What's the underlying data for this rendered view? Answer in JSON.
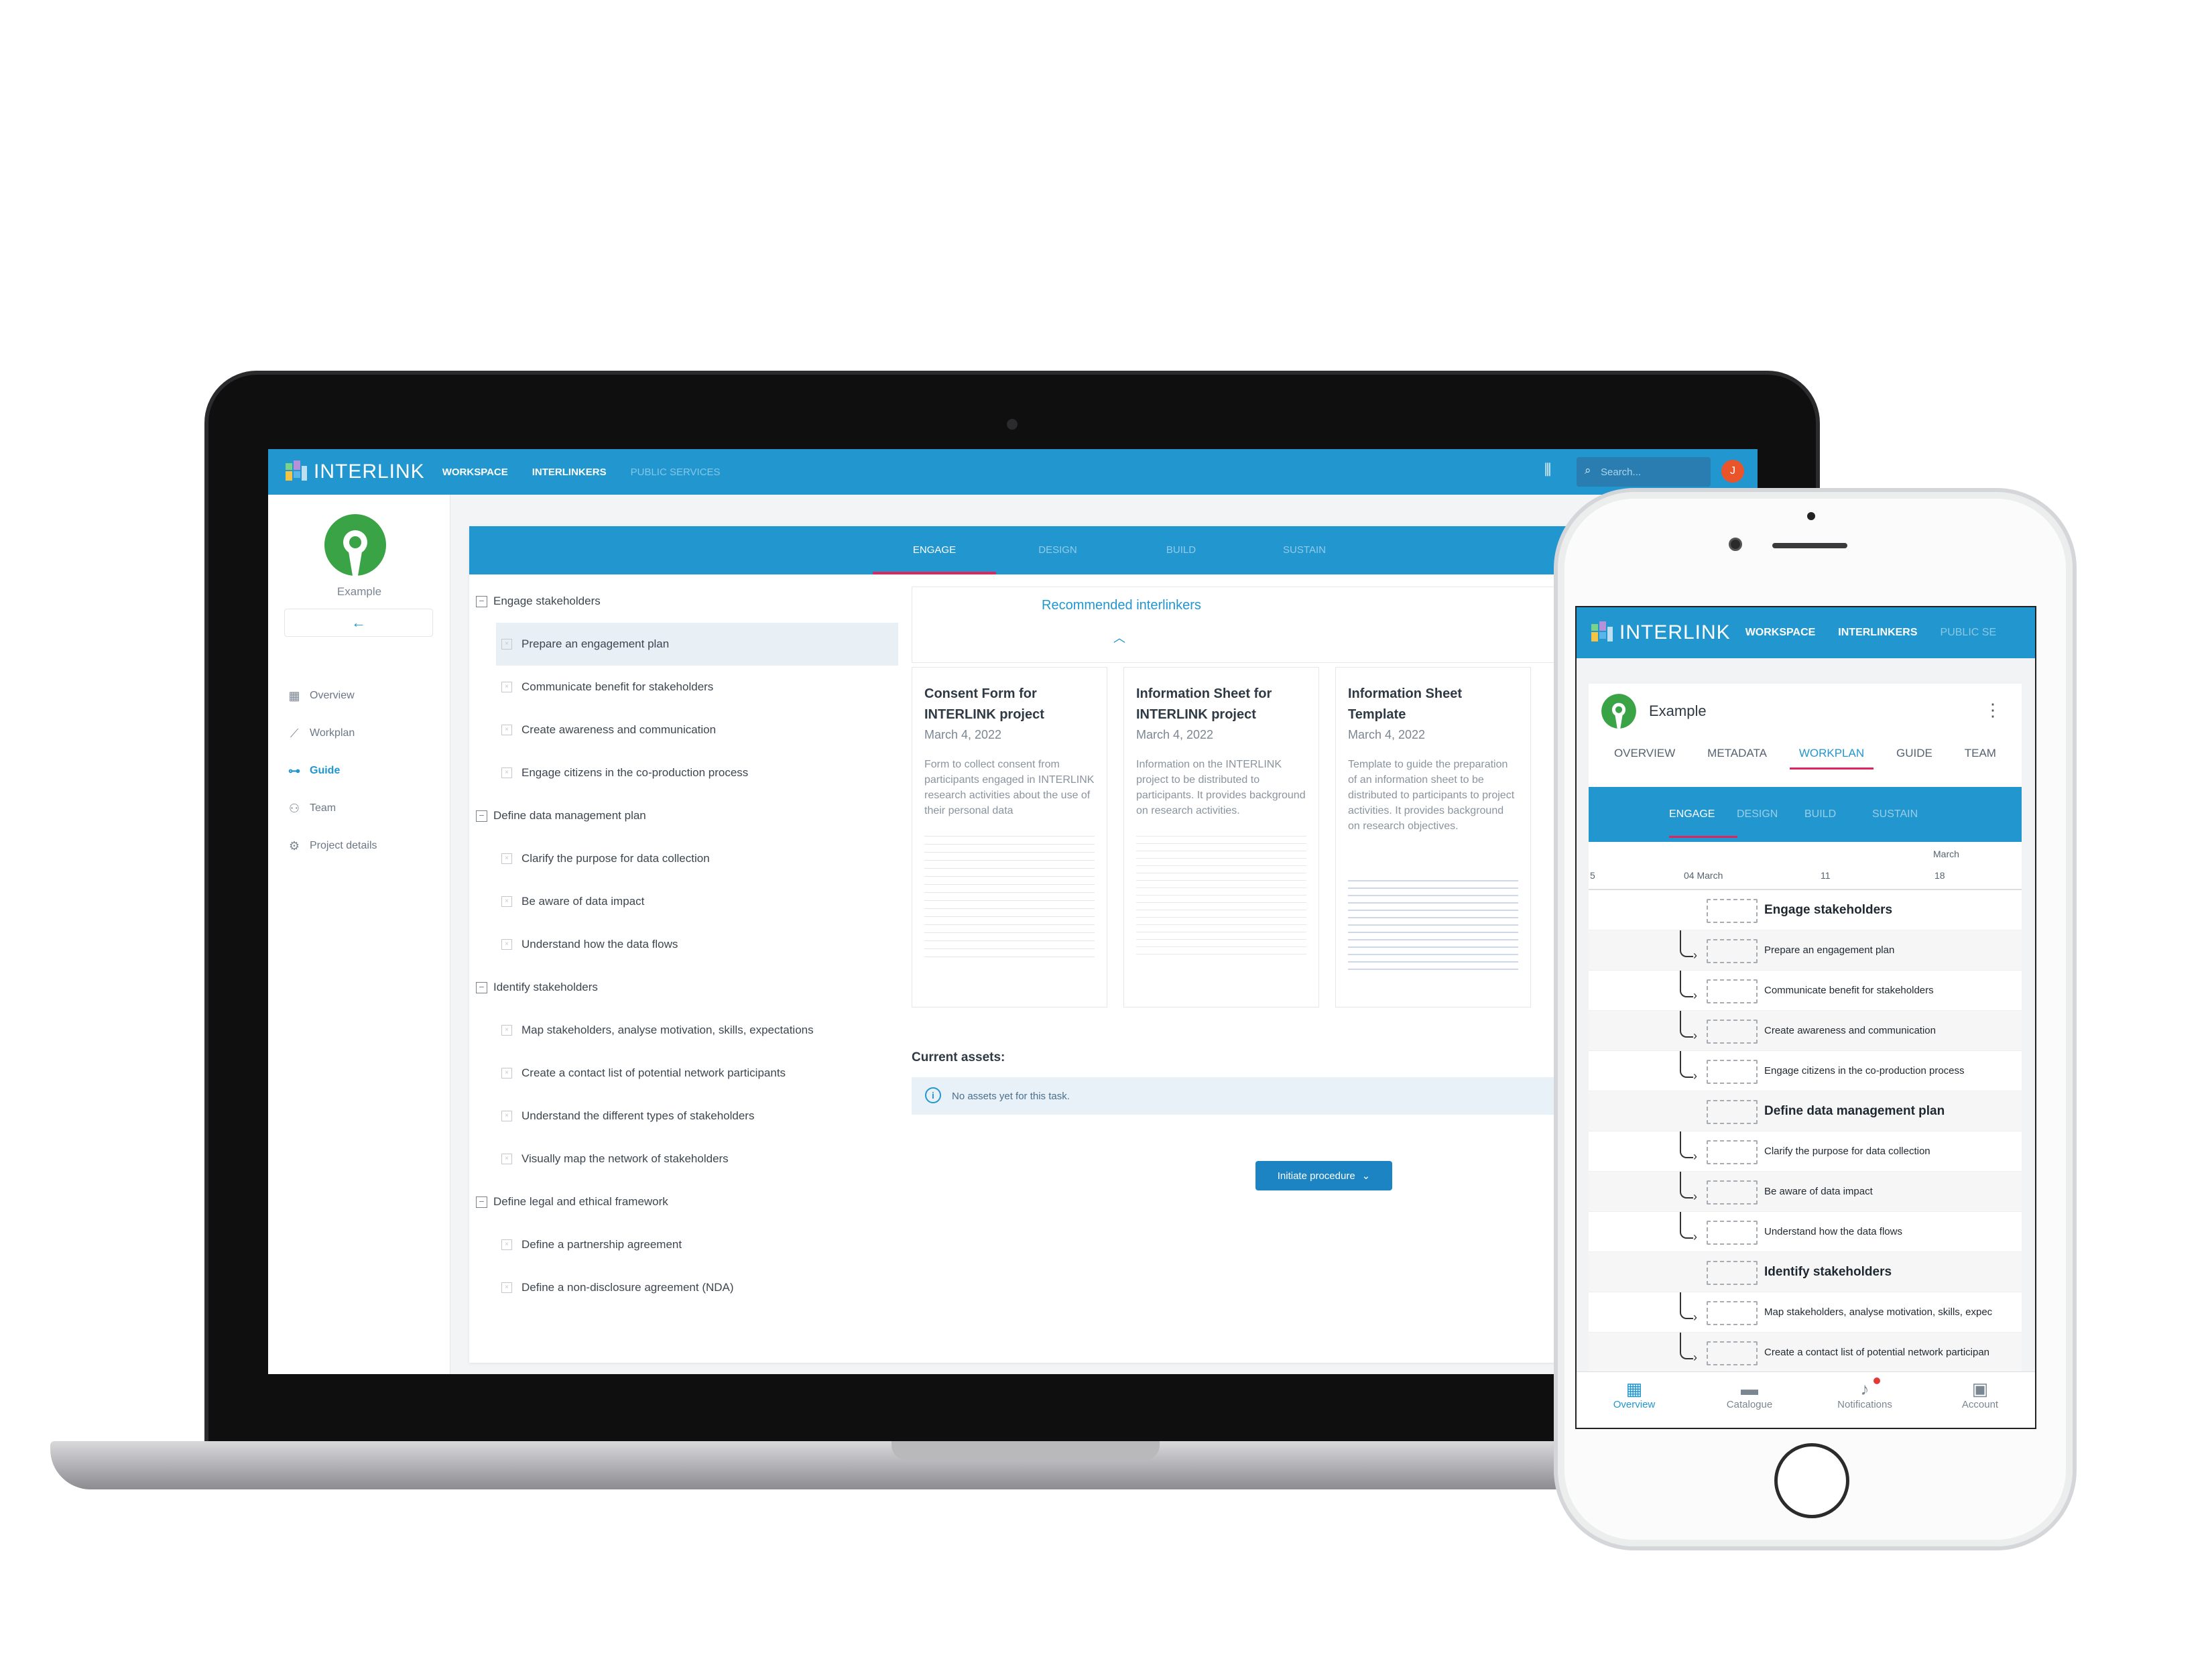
{
  "colors": {
    "brand": "#2196cf",
    "accent": "#e0245e",
    "button": "#1c84c3"
  },
  "desktop": {
    "brand": "INTERLINK",
    "nav": [
      "WORKSPACE",
      "INTERLINKERS",
      "PUBLIC SERVICES"
    ],
    "search_placeholder": "Search...",
    "avatar_initial": "J",
    "project_name": "Example",
    "menu": [
      "Overview",
      "Workplan",
      "Guide",
      "Team",
      "Project details"
    ],
    "phases": [
      "ENGAGE",
      "DESIGN",
      "BUILD",
      "SUSTAIN"
    ],
    "tree": [
      {
        "section": "Engage stakeholders",
        "tasks": [
          "Prepare an engagement plan",
          "Communicate benefit for stakeholders",
          "Create awareness and communication",
          "Engage citizens in the co-production process"
        ]
      },
      {
        "section": "Define data management plan",
        "tasks": [
          "Clarify the purpose for data collection",
          "Be aware of data impact",
          "Understand how the data flows"
        ]
      },
      {
        "section": "Identify stakeholders",
        "tasks": [
          "Map stakeholders, analyse motivation, skills, expectations",
          "Create a contact list of potential network participants",
          "Understand the different types of stakeholders",
          "Visually map the network of stakeholders"
        ]
      },
      {
        "section": "Define legal and ethical framework",
        "tasks": [
          "Define a partnership agreement",
          "Define a non-disclosure agreement (NDA)"
        ]
      }
    ],
    "recommended_title": "Recommended interlinkers",
    "docs": [
      {
        "title": "Consent Form for INTERLINK project",
        "date": "March 4, 2022",
        "desc": "Form to collect consent from participants engaged in INTERLINK research activities about the use of their personal data"
      },
      {
        "title": "Information Sheet for INTERLINK project",
        "date": "March 4, 2022",
        "desc": "Information on the INTERLINK project to be distributed to participants. It provides background on research activities."
      },
      {
        "title": "Information Sheet Template",
        "date": "March 4, 2022",
        "desc": "Template to guide the preparation of an information sheet to be distributed to participants to project activities. It provides background on research objectives."
      }
    ],
    "assets_heading": "Current assets:",
    "assets_empty": "No assets yet for this task.",
    "initiate_button": "Initiate procedure"
  },
  "mobile": {
    "brand": "INTERLINK",
    "nav": [
      "WORKSPACE",
      "INTERLINKERS",
      "PUBLIC SE"
    ],
    "project_name": "Example",
    "tabs": [
      "OVERVIEW",
      "METADATA",
      "WORKPLAN",
      "GUIDE",
      "TEAM"
    ],
    "phases": [
      "ENGAGE",
      "DESIGN",
      "BUILD",
      "SUSTAIN"
    ],
    "timeline": {
      "month": "March",
      "ticks": [
        "5",
        "04 March",
        "11",
        "18"
      ]
    },
    "rows": [
      {
        "label": "Engage stakeholders",
        "header": true
      },
      {
        "label": "Prepare an engagement plan",
        "header": false
      },
      {
        "label": "Communicate benefit for stakeholders",
        "header": false
      },
      {
        "label": "Create awareness and communication",
        "header": false
      },
      {
        "label": "Engage citizens in the co-production process",
        "header": false
      },
      {
        "label": "Define data management plan",
        "header": true
      },
      {
        "label": "Clarify the purpose for data collection",
        "header": false
      },
      {
        "label": "Be aware of data impact",
        "header": false
      },
      {
        "label": "Understand how the data flows",
        "header": false
      },
      {
        "label": "Identify stakeholders",
        "header": true
      },
      {
        "label": "Map stakeholders, analyse motivation, skills, expec",
        "header": false
      },
      {
        "label": "Create a contact list of potential network participan",
        "header": false
      }
    ],
    "bottom_nav": [
      "Overview",
      "Catalogue",
      "Notifications",
      "Account"
    ]
  }
}
